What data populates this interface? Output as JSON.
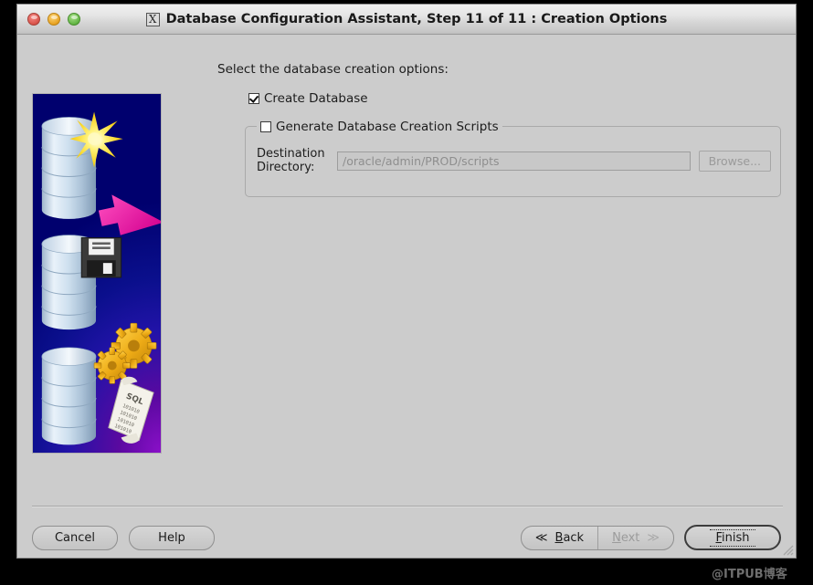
{
  "window": {
    "title": "Database Configuration Assistant, Step 11 of 11 : Creation Options",
    "app_icon": "x11-icon",
    "controls": {
      "close": "close-button",
      "minimize": "minimize-button",
      "maximize": "maximize-button"
    }
  },
  "main": {
    "instruction": "Select the database creation options:",
    "create_database": {
      "label": "Create Database",
      "checked": true
    },
    "generate_scripts": {
      "label": "Generate Database Creation Scripts",
      "checked": false
    },
    "destination": {
      "label_line1": "Destination",
      "label_line2": "Directory:",
      "value": "/oracle/admin/PROD/scripts",
      "browse_label": "Browse..."
    }
  },
  "footer": {
    "cancel": "Cancel",
    "help": "Help",
    "back": "Back",
    "back_mnemonic": "B",
    "back_arrow": "≪",
    "next": "Next",
    "next_mnemonic": "N",
    "next_arrow": "≫",
    "finish": "Finish",
    "finish_mnemonic": "F"
  },
  "watermark": "@ITPUB博客",
  "colors": {
    "window_bg": "#cccccc",
    "titlebar_top": "#f0f0f0",
    "titlebar_bottom": "#bfbfbf",
    "graphic_blue": "#0404a8",
    "graphic_purple": "#8a10c8",
    "arrow_pink": "#e81fa5",
    "star_yellow": "#ffe000",
    "gear_gold": "#e8a81c",
    "cylinder_light": "#e4eef8",
    "disabled_text": "#9a9a9a"
  }
}
